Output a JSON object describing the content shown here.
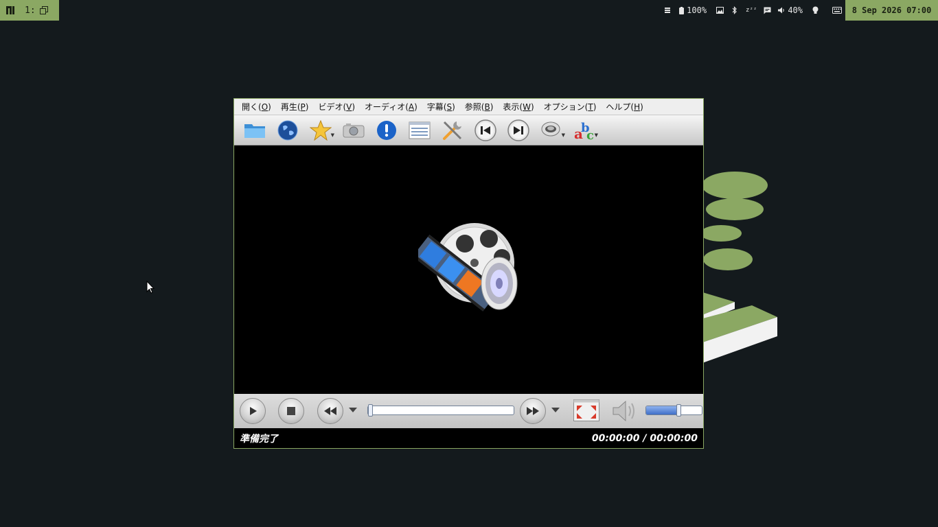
{
  "topbar": {
    "workspace": "1:",
    "tray": {
      "battery": "100%",
      "volume": "40%"
    },
    "clock": "8 Sep 2026 07:00"
  },
  "player": {
    "menu": [
      {
        "label": "開く(",
        "key": "O",
        "end": ")"
      },
      {
        "label": "再生(",
        "key": "P",
        "end": ")"
      },
      {
        "label": "ビデオ(",
        "key": "V",
        "end": ")"
      },
      {
        "label": "オーディオ(",
        "key": "A",
        "end": ")"
      },
      {
        "label": "字幕(",
        "key": "S",
        "end": ")"
      },
      {
        "label": "参照(",
        "key": "B",
        "end": ")"
      },
      {
        "label": "表示(",
        "key": "W",
        "end": ")"
      },
      {
        "label": "オプション(",
        "key": "T",
        "end": ")"
      },
      {
        "label": "ヘルプ(",
        "key": "H",
        "end": ")"
      }
    ],
    "status_text": "準備完了",
    "time_display": "00:00:00 / 00:00:00",
    "seek_progress": 0,
    "volume_level": 0.58
  },
  "colors": {
    "accent": "#8ba863",
    "desktop": "#141a1d"
  }
}
